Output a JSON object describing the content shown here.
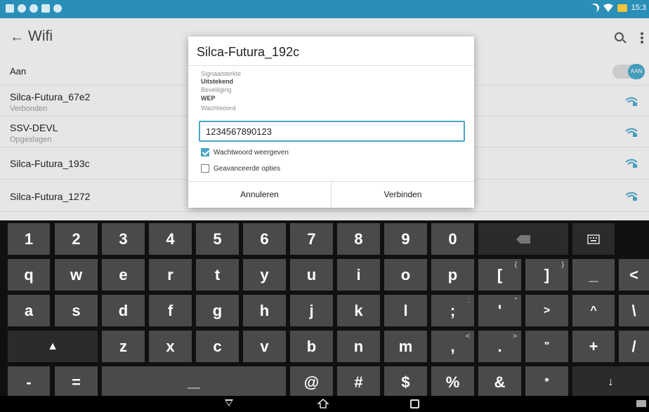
{
  "status_bar": {
    "time": "15:3"
  },
  "screen": {
    "title": "Wifi",
    "toggle_row": {
      "label": "Aan",
      "toggle_text": "AAN"
    },
    "networks": [
      {
        "name": "Silca-Futura_67e2",
        "status": "Verbonden"
      },
      {
        "name": "SSV-DEVL",
        "status": "Opgeslagen"
      },
      {
        "name": "Silca-Futura_193c",
        "status": ""
      },
      {
        "name": "Silca-Futura_1272",
        "status": ""
      }
    ]
  },
  "dialog": {
    "title": "Silca-Futura_192c",
    "signal_label": "Signaalsterkte",
    "signal_value": "Uitstekend",
    "security_label": "Beveiliging",
    "security_value": "WEP",
    "password_label": "Wachtwoord",
    "password_value": "1234567890123",
    "show_password_label": "Wachtwoord weergeven",
    "show_password_checked": true,
    "advanced_label": "Geavanceerde opties",
    "advanced_checked": false,
    "cancel_label": "Annuleren",
    "connect_label": "Verbinden"
  },
  "keyboard": {
    "row1": [
      "1",
      "2",
      "3",
      "4",
      "5",
      "6",
      "7",
      "8",
      "9",
      "0"
    ],
    "row2": [
      "q",
      "w",
      "e",
      "r",
      "t",
      "y",
      "u",
      "i",
      "o",
      "p",
      "[",
      "]",
      "_",
      "<"
    ],
    "row2_alt": [
      "",
      "",
      "",
      "",
      "",
      "",
      "",
      "",
      "",
      "",
      "{",
      "}",
      "",
      ""
    ],
    "row3": [
      "a",
      "s",
      "d",
      "f",
      "g",
      "h",
      "j",
      "k",
      "l",
      ";",
      "'",
      ">",
      "^",
      "\\"
    ],
    "row3_alt": [
      "",
      "",
      "",
      "",
      "",
      "",
      "",
      "",
      "",
      ":",
      "\"",
      "",
      "",
      ""
    ],
    "row4": [
      "z",
      "x",
      "c",
      "v",
      "b",
      "n",
      "m",
      ",",
      ".",
      "\"",
      "+",
      "/"
    ],
    "row4_alt": [
      "",
      "",
      "",
      "",
      "",
      "",
      "",
      "<",
      ">",
      "",
      "",
      ""
    ],
    "row5": [
      "-",
      "=",
      "@",
      "#",
      "$",
      "%",
      "&",
      "*",
      "↓"
    ],
    "shift_symbol": "▲"
  }
}
